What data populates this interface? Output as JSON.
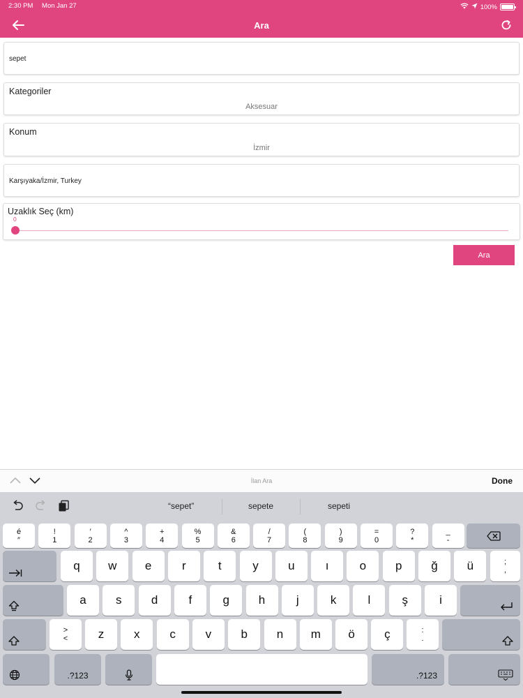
{
  "status_bar": {
    "time": "2:30 PM",
    "date": "Mon Jan 27",
    "battery": "100%"
  },
  "header": {
    "title": "Ara",
    "back_icon": "arrow-left-icon",
    "refresh_icon": "refresh-icon",
    "color": "#e0457f"
  },
  "form": {
    "search_value": "sepet",
    "category": {
      "label": "Kategoriler",
      "value": "Aksesuar"
    },
    "location": {
      "label": "Konum",
      "value": "İzmir"
    },
    "address_value": "Karşıyaka/İzmir, Turkey",
    "distance": {
      "label": "Uzaklık Seç (km)",
      "value": "0"
    },
    "search_button": "Ara"
  },
  "keyboard_accessory": {
    "placeholder": "İlan Ara",
    "done": "Done"
  },
  "suggestions": [
    "“sepet”",
    "sepete",
    "sepeti"
  ],
  "keyboard": {
    "number_row": [
      {
        "top": "é",
        "bottom": "″"
      },
      {
        "top": "!",
        "bottom": "1"
      },
      {
        "top": "′",
        "bottom": "2"
      },
      {
        "top": "^",
        "bottom": "3"
      },
      {
        "top": "+",
        "bottom": "4"
      },
      {
        "top": "%",
        "bottom": "5"
      },
      {
        "top": "&",
        "bottom": "6"
      },
      {
        "top": "/",
        "bottom": "7"
      },
      {
        "top": "(",
        "bottom": "8"
      },
      {
        "top": ")",
        "bottom": "9"
      },
      {
        "top": "=",
        "bottom": "0"
      },
      {
        "top": "?",
        "bottom": "*"
      },
      {
        "top": "_",
        "bottom": "-"
      }
    ],
    "row1": [
      "q",
      "w",
      "e",
      "r",
      "t",
      "y",
      "u",
      "ı",
      "o",
      "p",
      "ğ",
      "ü"
    ],
    "row1_end": {
      "top": ";",
      "bottom": ","
    },
    "row2": [
      "a",
      "s",
      "d",
      "f",
      "g",
      "h",
      "j",
      "k",
      "l",
      "ş",
      "i"
    ],
    "row3_start": {
      "top": ">",
      "bottom": "<"
    },
    "row3": [
      "z",
      "x",
      "c",
      "v",
      "b",
      "n",
      "m",
      "ö",
      "ç"
    ],
    "row3_end": {
      "top": ":",
      "bottom": "."
    },
    "numbers_label": ".?123"
  }
}
